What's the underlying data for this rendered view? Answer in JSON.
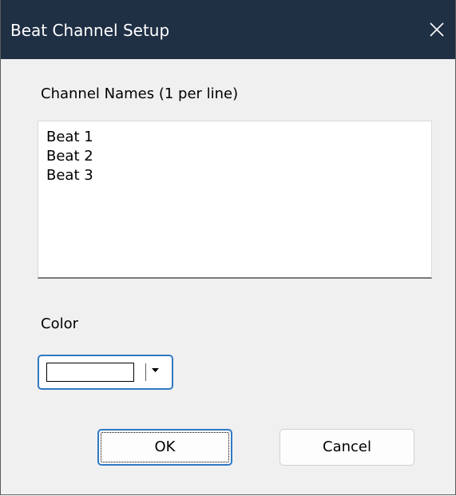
{
  "window": {
    "title": "Beat Channel Setup",
    "close_icon": "close-icon",
    "titlebar_color": "#1f2f44"
  },
  "channel_names": {
    "label": "Channel Names (1 per line)",
    "lines": [
      "Beat 1",
      "Beat 2",
      "Beat 3"
    ]
  },
  "color": {
    "label": "Color",
    "selected_value_color": "#ffffff",
    "dropdown_icon": "dropdown-arrow-icon"
  },
  "buttons": {
    "ok_label": "OK",
    "cancel_label": "Cancel"
  },
  "accent_color": "#2f78c4"
}
